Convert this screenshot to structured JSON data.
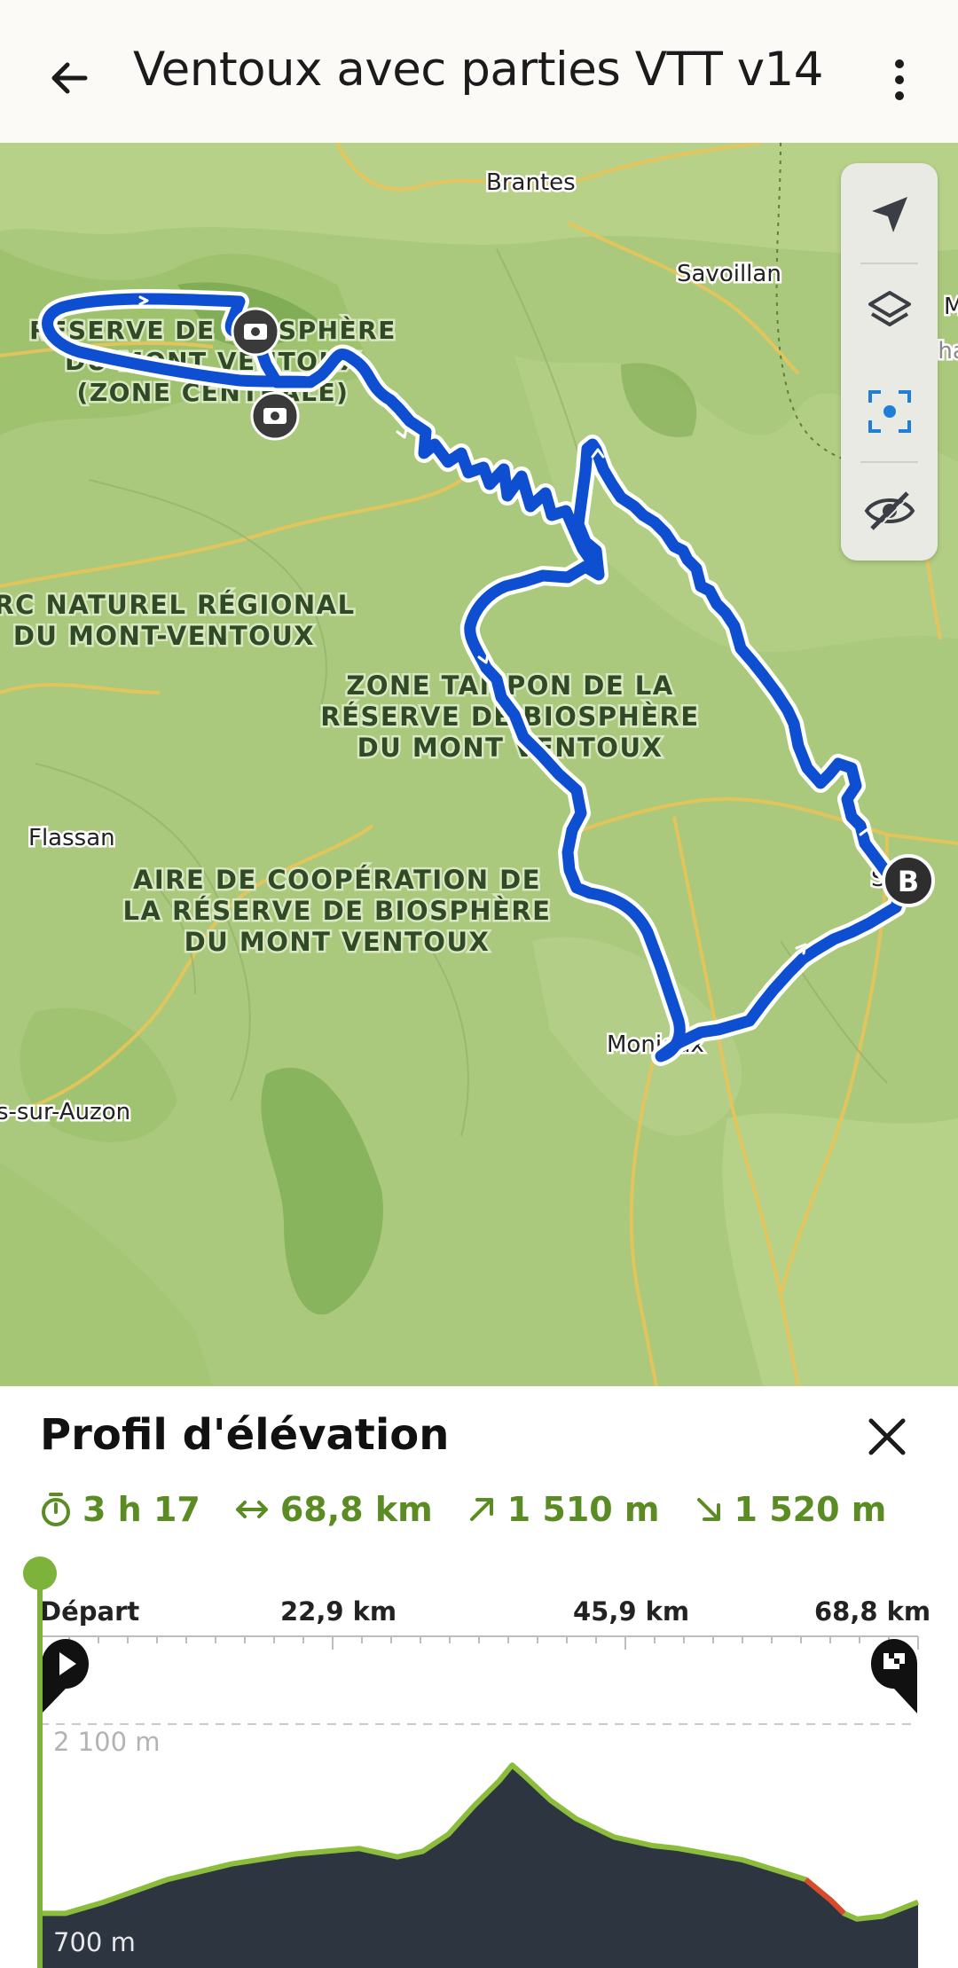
{
  "header": {
    "title": "Ventoux avec parties VTT v14"
  },
  "map": {
    "places": {
      "brantes": "Brantes",
      "savoillan": "Savoillan",
      "flassan": "Flassan",
      "monieux": "Monieux",
      "sault": "Sa",
      "auzon": "s-sur-Auzon",
      "reilh": "Reilha",
      "m_edge": "M"
    },
    "zones": {
      "reserve_centrale": [
        "RÉSERVE DE BIOSPHÈRE",
        "DU MONT VENTOUX",
        "(ZONE CENTRALE)"
      ],
      "parc": [
        "ARC NATUREL RÉGIONAL",
        "DU MONT-VENTOUX"
      ],
      "tampon": [
        "ZONE TAMPON DE LA",
        "RÉSERVE DE BIOSPHÈRE",
        "DU MONT VENTOUX"
      ],
      "aire": [
        "AIRE DE COOPÉRATION DE",
        "LA RÉSERVE DE BIOSPHÈRE",
        "DU MONT VENTOUX"
      ]
    },
    "marker_b": "B",
    "controls": [
      "navigate-icon",
      "layers-icon",
      "recenter-icon",
      "hide-icon"
    ],
    "colors": {
      "route": "#0e4fd1",
      "terrain": "#a9c97a",
      "forest": "#7fae55"
    }
  },
  "elevation": {
    "title": "Profil d'élévation",
    "stats": {
      "duration": "3 h 17",
      "distance": "68,8 km",
      "ascent": "1 510 m",
      "descent": "1 520 m"
    },
    "km_labels": [
      "Départ",
      "22,9 km",
      "45,9 km",
      "68,8 km"
    ],
    "elev_labels": {
      "top": "2 100 m",
      "bottom": "700 m"
    },
    "profile_data": {
      "distance_km": [
        0,
        2,
        5,
        10,
        15,
        20,
        25,
        28,
        30,
        32,
        34,
        36,
        37,
        38,
        40,
        42,
        45,
        48,
        50,
        55,
        60,
        62,
        63,
        64,
        66,
        68.8
      ],
      "elevation_m": [
        760,
        760,
        840,
        1000,
        1110,
        1180,
        1220,
        1160,
        1200,
        1320,
        1520,
        1700,
        1810,
        1730,
        1560,
        1430,
        1300,
        1240,
        1220,
        1140,
        1000,
        850,
        760,
        720,
        740,
        840
      ]
    },
    "colors": {
      "accent": "#5a8c23",
      "fill": "#2c3540",
      "steep": "#d84a2a"
    }
  }
}
